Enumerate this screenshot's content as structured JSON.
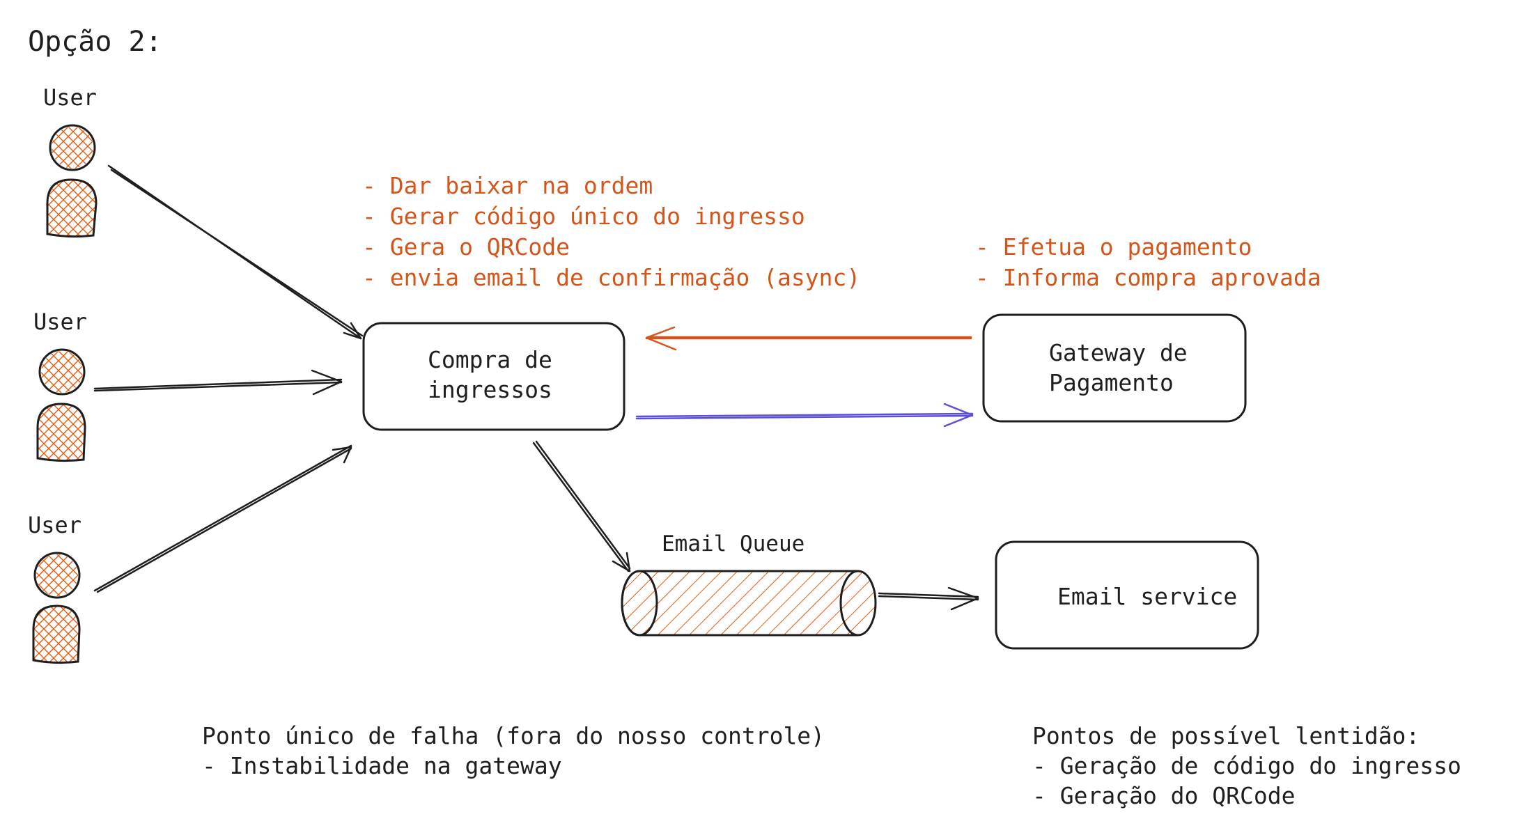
{
  "title": "Opção 2:",
  "users": [
    {
      "label": "User"
    },
    {
      "label": "User"
    },
    {
      "label": "User"
    }
  ],
  "nodes": {
    "compra": {
      "line1": "Compra de",
      "line2": "ingressos"
    },
    "gateway": {
      "line1": "Gateway de",
      "line2": "Pagamento"
    },
    "email_service": {
      "label": "Email service"
    },
    "queue": {
      "label": "Email Queue"
    }
  },
  "notes": {
    "compra_tasks": [
      "- Dar baixar na ordem",
      "- Gerar código único do ingresso",
      "- Gera o QRCode",
      "- envia email de confirmação (async)"
    ],
    "gateway_tasks": [
      "- Efetua o pagamento",
      "- Informa compra aprovada"
    ],
    "single_point": [
      "Ponto único de falha (fora do nosso controle)",
      "- Instabilidade na gateway"
    ],
    "slowness": [
      "Pontos de possível lentidão:",
      "- Geração de código do ingresso",
      "- Geração do QRCode"
    ]
  },
  "colors": {
    "ink": "#1e1e1e",
    "accent_orange": "#d4551a",
    "fill_orange": "#f4a261",
    "arrow_blue": "#5b4fd6"
  }
}
